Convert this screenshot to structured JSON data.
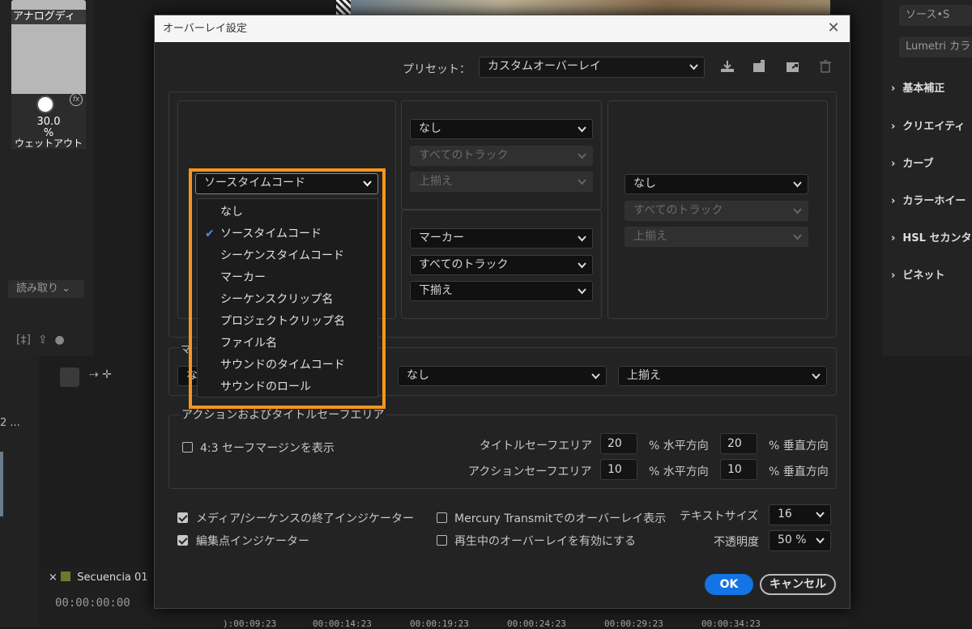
{
  "background": {
    "channel": {
      "label": "アナログディ",
      "value": "30.0",
      "unit": "%",
      "sub": "ウェットアウト"
    },
    "read_mode": "読み取り",
    "right_panel": {
      "top_tab": "ソース•S",
      "lumetri_tab": "Lumetri カラ",
      "items": [
        "基本補正",
        "クリエイティ",
        "カーブ",
        "カラーホイー",
        "HSL セカンタ",
        "ビネット"
      ]
    },
    "sequence": {
      "tab": "Secuencia 01",
      "timecode": "00:00:00:00",
      "ruler": [
        "):00:09:23",
        "00:00:14:23",
        "00:00:19:23",
        "00:00:24:23",
        "00:00:29:23",
        "00:00:34:23"
      ]
    },
    "left_text": "2 ..."
  },
  "dialog": {
    "title": "オーバーレイ設定",
    "preset_label": "プリセット：",
    "preset_value": "カスタムオーバーレイ",
    "preset_icons": [
      "save-preset-icon",
      "import-preset-icon",
      "export-preset-icon",
      "delete-preset-icon"
    ],
    "left_select": "ソースタイムコード",
    "dropdown_items": [
      "なし",
      "ソースタイムコード",
      "シーケンスタイムコード",
      "マーカー",
      "シーケンスクリップ名",
      "プロジェクトクリップ名",
      "ファイル名",
      "サウンドのタイムコード",
      "サウンドのロール"
    ],
    "dropdown_selected": "ソースタイムコード",
    "top_middle": {
      "content": "なし",
      "track": "すべてのトラック",
      "align": "上揃え"
    },
    "bottom_middle": {
      "content": "マーカー",
      "track": "すべてのトラック",
      "align": "下揃え"
    },
    "right": {
      "content": "なし",
      "track": "すべてのトラック",
      "align": "上揃え"
    },
    "marker_row": {
      "section_label_partial": "マ",
      "left_partial": "な",
      "middle": "なし",
      "right": "上揃え"
    },
    "safe_area": {
      "section_title": "アクションおよびタイトルセーフエリア",
      "margin_checkbox": "4:3 セーフマージンを表示",
      "margin_checked": false,
      "title_safe_label": "タイトルセーフエリア",
      "title_h": "20",
      "title_v": "20",
      "action_safe_label": "アクションセーフエリア",
      "action_h": "10",
      "action_v": "10",
      "h_unit": "% 水平方向",
      "v_unit": "% 垂直方向"
    },
    "options": {
      "end_indicator": "メディア/シーケンスの終了インジケーター",
      "end_indicator_checked": true,
      "edit_point": "編集点インジケーター",
      "edit_point_checked": true,
      "mercury": "Mercury Transmitでのオーバーレイ表示",
      "mercury_checked": false,
      "playback": "再生中のオーバーレイを有効にする",
      "playback_checked": false,
      "text_size_label": "テキストサイズ",
      "text_size": "16",
      "opacity_label": "不透明度",
      "opacity": "50 %"
    },
    "ok": "OK",
    "cancel": "キャンセル"
  },
  "colors": {
    "accent": "#1473e6",
    "highlight": "#f5961e",
    "check": "#4a8ff0"
  }
}
